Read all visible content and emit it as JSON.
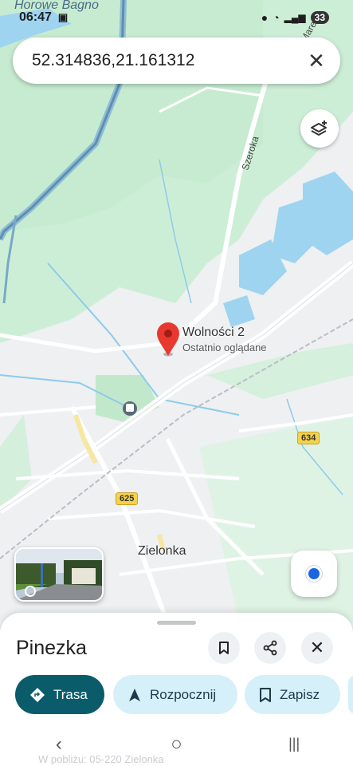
{
  "status_bar": {
    "time": "06:47",
    "battery": "33"
  },
  "map": {
    "corner_place": "Horowe Bagno",
    "street_szeroka": "Szeroka",
    "street_top_right": "Marec",
    "town": "Zielonka",
    "road_badge_625": "625",
    "road_badge_634": "634",
    "pin": {
      "title": "Wolności 2",
      "subtitle": "Ostatnio oglądane"
    }
  },
  "search": {
    "value": "52.314836,21.161312"
  },
  "icons": {
    "clear": "close-icon",
    "layers": "layers-icon",
    "location": "my-location-icon",
    "save": "bookmark-icon",
    "share": "share-icon",
    "close": "close-icon"
  },
  "sheet": {
    "title": "Pinezka",
    "actions": [
      {
        "label": "Trasa",
        "icon": "directions-icon"
      },
      {
        "label": "Rozpocznij",
        "icon": "navigation-arrow-icon"
      },
      {
        "label": "Zapisz",
        "icon": "bookmark-icon"
      }
    ],
    "hidden_hint": "W pobliżu: 05-220 Zielonka"
  },
  "colors": {
    "accent": "#0b5c6b",
    "chip": "#d5f0f8",
    "pin": "#e8392f",
    "location": "#1a66e0"
  }
}
